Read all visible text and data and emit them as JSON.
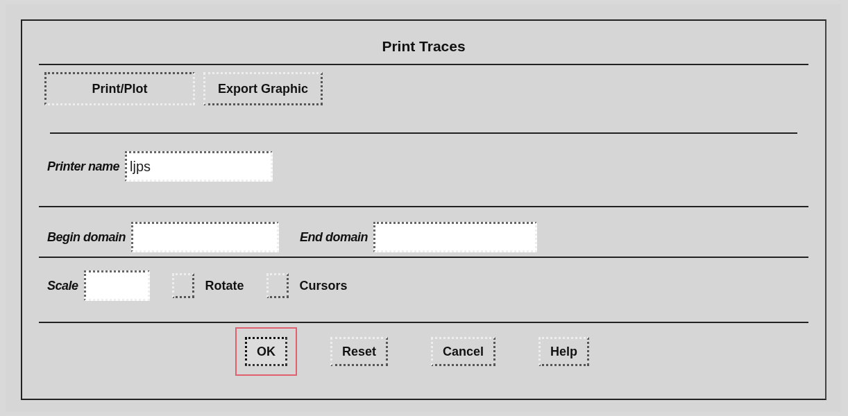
{
  "dialog": {
    "title": "Print Traces"
  },
  "tabs": [
    {
      "label": "Print/Plot",
      "selected": true
    },
    {
      "label": "Export Graphic",
      "selected": false
    }
  ],
  "printer_name": {
    "label": "Printer name",
    "value": "ljps"
  },
  "begin_domain": {
    "label": "Begin domain"
  },
  "end_domain": {
    "label": "End domain"
  },
  "scale": {
    "label": "Scale"
  },
  "options": [
    {
      "label": "Rotate",
      "checked": false
    },
    {
      "label": "Cursors",
      "checked": false
    }
  ],
  "buttons": [
    {
      "label": "OK",
      "focused": true
    },
    {
      "label": "Reset",
      "focused": false
    },
    {
      "label": "Cancel",
      "focused": false
    },
    {
      "label": "Help",
      "focused": false
    }
  ]
}
